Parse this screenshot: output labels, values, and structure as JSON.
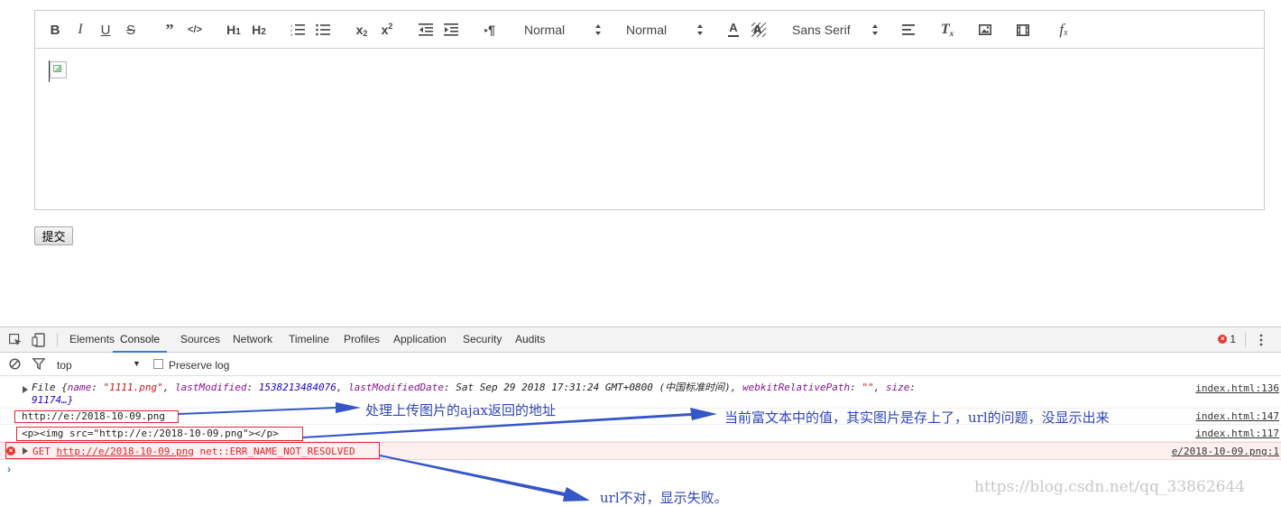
{
  "editor": {
    "toolbar": {
      "header_picker_value": "Normal",
      "size_picker_value": "Normal",
      "font_picker_value": "Sans Serif",
      "icons": [
        "bold-icon",
        "italic-icon",
        "underline-icon",
        "strike-icon",
        "blockquote-icon",
        "code-block-icon",
        "header-1-icon",
        "header-2-icon",
        "ordered-list-icon",
        "bullet-list-icon",
        "subscript-icon",
        "superscript-icon",
        "outdent-icon",
        "indent-icon",
        "rtl-icon",
        "color-icon",
        "background-icon",
        "align-icon",
        "clean-icon",
        "image-icon",
        "video-icon",
        "formula-icon"
      ]
    }
  },
  "form": {
    "submit_label": "提交"
  },
  "devtools": {
    "tabs": [
      "Elements",
      "Console",
      "Sources",
      "Network",
      "Timeline",
      "Profiles",
      "Application",
      "Security",
      "Audits"
    ],
    "active_tab": "Console",
    "error_count": "1",
    "filter": {
      "context": "top",
      "preserve_log_label": "Preserve log"
    },
    "log1": {
      "prefix": "File {",
      "name_key": "name",
      "name_val": "\"1111.png\"",
      "lm_key": "lastModified",
      "lm_val": "1538213484076",
      "lmd_key": "lastModifiedDate",
      "lmd_val": "Sat Sep 29 2018 17:31:24 GMT+0800 (中国标准时间)",
      "wrp_key": "webkitRelativePath",
      "wrp_val": "\"\"",
      "size_key": "size",
      "size_val": "91174…}",
      "source": "index.html:136"
    },
    "log2": {
      "text": "http://e:/2018-10-09.png",
      "source": "index.html:147"
    },
    "log3": {
      "text": "<p><img src=\"http://e:/2018-10-09.png\"></p>",
      "source": "index.html:117"
    },
    "log4": {
      "method": "GET",
      "url": "http://e/2018-10-09.png",
      "error": "net::ERR_NAME_NOT_RESOLVED",
      "source": "e/2018-10-09.png:1"
    },
    "prompt": "›"
  },
  "annotations": {
    "note1": "处理上传图片的ajax返回的地址",
    "note2": "当前富文本中的值，其实图片是存上了，url的问题，没显示出来",
    "note3": "url不对，显示失败。",
    "colors": {
      "arrow": "#3556c8",
      "box": "#e3262e"
    }
  },
  "watermark": "https://blog.csdn.net/qq_33862644"
}
